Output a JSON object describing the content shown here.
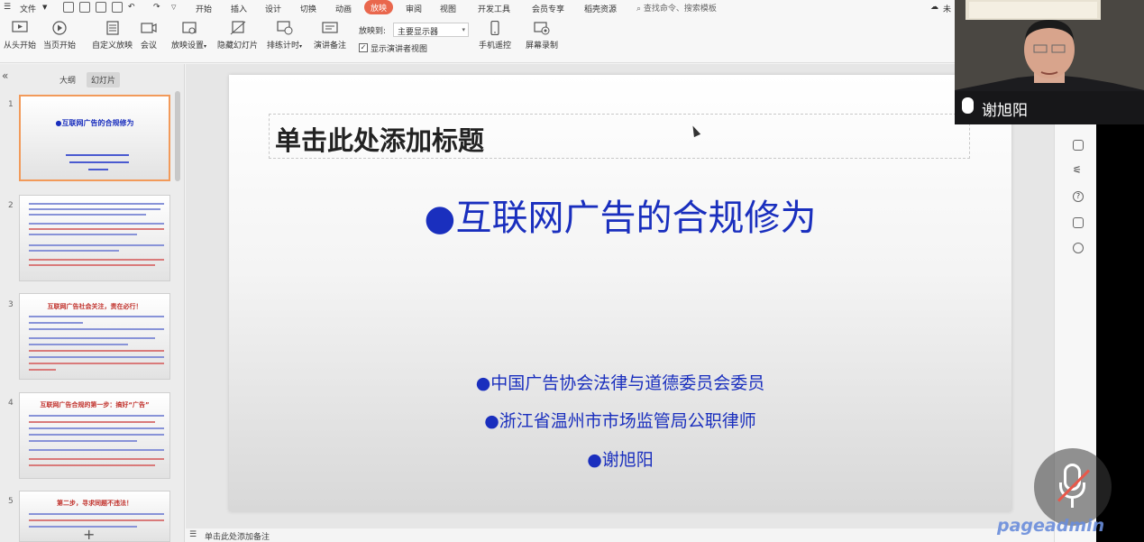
{
  "menubar": {
    "file": "文件",
    "tabs": [
      "开始",
      "插入",
      "设计",
      "切换",
      "动画",
      "放映",
      "审阅",
      "视图",
      "开发工具",
      "会员专享",
      "稻壳资源"
    ],
    "active_tab": "放映",
    "search_placeholder": "查找命令、搜索模板",
    "cloud_label": "未"
  },
  "ribbon": {
    "from_start": "从头开始",
    "from_current": "当页开始",
    "custom_show": "自定义放映",
    "meeting": "会议",
    "show_settings": "放映设置",
    "hide_slide": "隐藏幻灯片",
    "rehearse": "排练计时",
    "speaker_notes": "演讲备注",
    "show_on_label": "放映到:",
    "show_on_value": "主要显示器",
    "presenter_view": "显示演讲者视图",
    "phone_remote": "手机遥控",
    "screen_record": "屏幕录制"
  },
  "left_panel": {
    "tab_outline": "大纲",
    "tab_slides": "幻灯片",
    "thumbnails": [
      {
        "num": "1",
        "title": "●互联网广告的合规修为"
      },
      {
        "num": "2",
        "title": ""
      },
      {
        "num": "3",
        "title": "互联网广告社会关注，责在必行！"
      },
      {
        "num": "4",
        "title": "互联网广告合规的第一步：搞好“广告”"
      },
      {
        "num": "5",
        "title": "第二步，寻求同题不违法！"
      }
    ],
    "add_slide": "+"
  },
  "slide": {
    "title_placeholder": "单击此处添加标题",
    "main_title": "●互联网广告的合规修为",
    "subtitles": [
      "●中国广告协会法律与道德委员会委员",
      "●浙江省温州市市场监管局公职律师",
      "●谢旭阳"
    ]
  },
  "notes": {
    "placeholder": "单击此处添加备注"
  },
  "webcam": {
    "name": "谢旭阳"
  },
  "watermark": "pageadmin",
  "colors": {
    "accent": "#e9674d",
    "slide_text": "#1a2fbe",
    "selected_thumb_border": "#f29a5a"
  }
}
